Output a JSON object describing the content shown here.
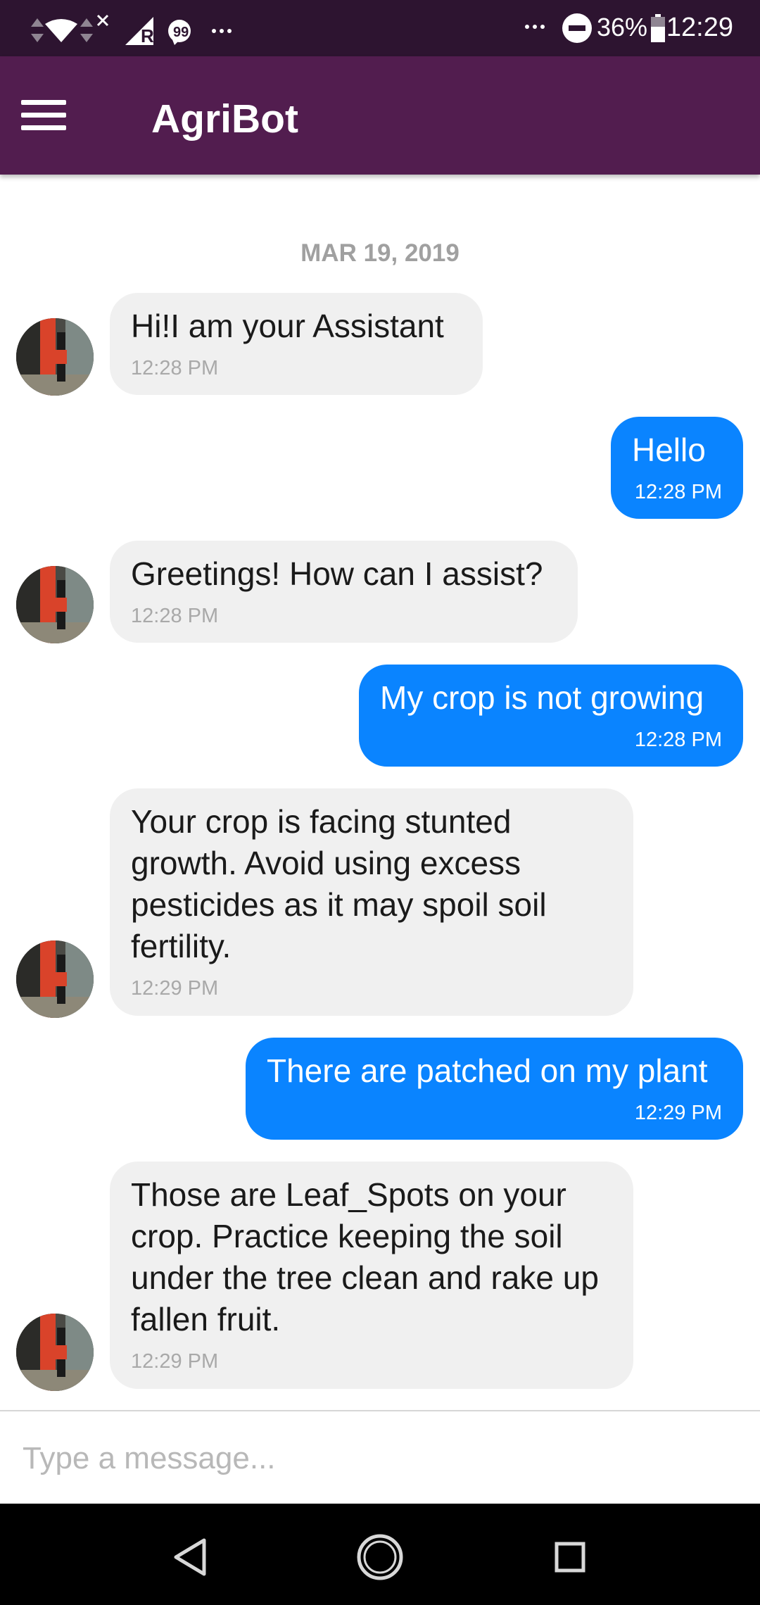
{
  "status_bar": {
    "battery_percent": "36%",
    "time": "12:29"
  },
  "app_bar": {
    "title": "AgriBot"
  },
  "chat": {
    "date": "MAR 19, 2019",
    "messages": [
      {
        "sender": "bot",
        "text": "Hi!I am your Assistant",
        "time": "12:28 PM"
      },
      {
        "sender": "user",
        "text": "Hello",
        "time": "12:28 PM"
      },
      {
        "sender": "bot",
        "text": "Greetings! How can I assist?",
        "time": "12:28 PM"
      },
      {
        "sender": "user",
        "text": "My crop is not growing",
        "time": "12:28 PM"
      },
      {
        "sender": "bot",
        "text": "Your crop is facing stunted\ngrowth. Avoid using excess\npesticides as it may spoil soil\nfertility.",
        "time": "12:29 PM"
      },
      {
        "sender": "user",
        "text": "There are patched on my plant",
        "time": "12:29 PM"
      },
      {
        "sender": "bot",
        "text": "Those are Leaf_Spots on your\ncrop. Practice keeping the soil\nunder the tree clean and rake up\nfallen fruit.",
        "time": "12:29 PM"
      }
    ]
  },
  "input": {
    "placeholder": "Type a message..."
  },
  "colors": {
    "status_bar": "#2d1430",
    "app_bar": "#521d4f",
    "user_bubble": "#0a84ff",
    "bot_bubble": "#f0f0f0"
  }
}
